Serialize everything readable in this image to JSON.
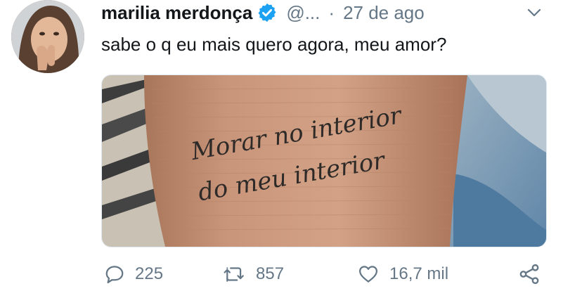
{
  "tweet": {
    "author_name": "marilia merdonça",
    "handle": "@...",
    "separator": "·",
    "date": "27 de ago",
    "text": "sabe o q eu mais quero agora, meu amor?",
    "image": {
      "tattoo_line1": "Morar no interior",
      "tattoo_line2": "do meu interior"
    },
    "actions": {
      "replies": "225",
      "retweets": "857",
      "likes": "16,7 mil"
    }
  },
  "colors": {
    "text": "#14171a",
    "secondary": "#657786",
    "verified": "#1da1f2"
  },
  "icons": [
    "avatar",
    "verified-badge-icon",
    "chevron-down-icon",
    "reply-icon",
    "retweet-icon",
    "like-icon",
    "share-icon"
  ]
}
